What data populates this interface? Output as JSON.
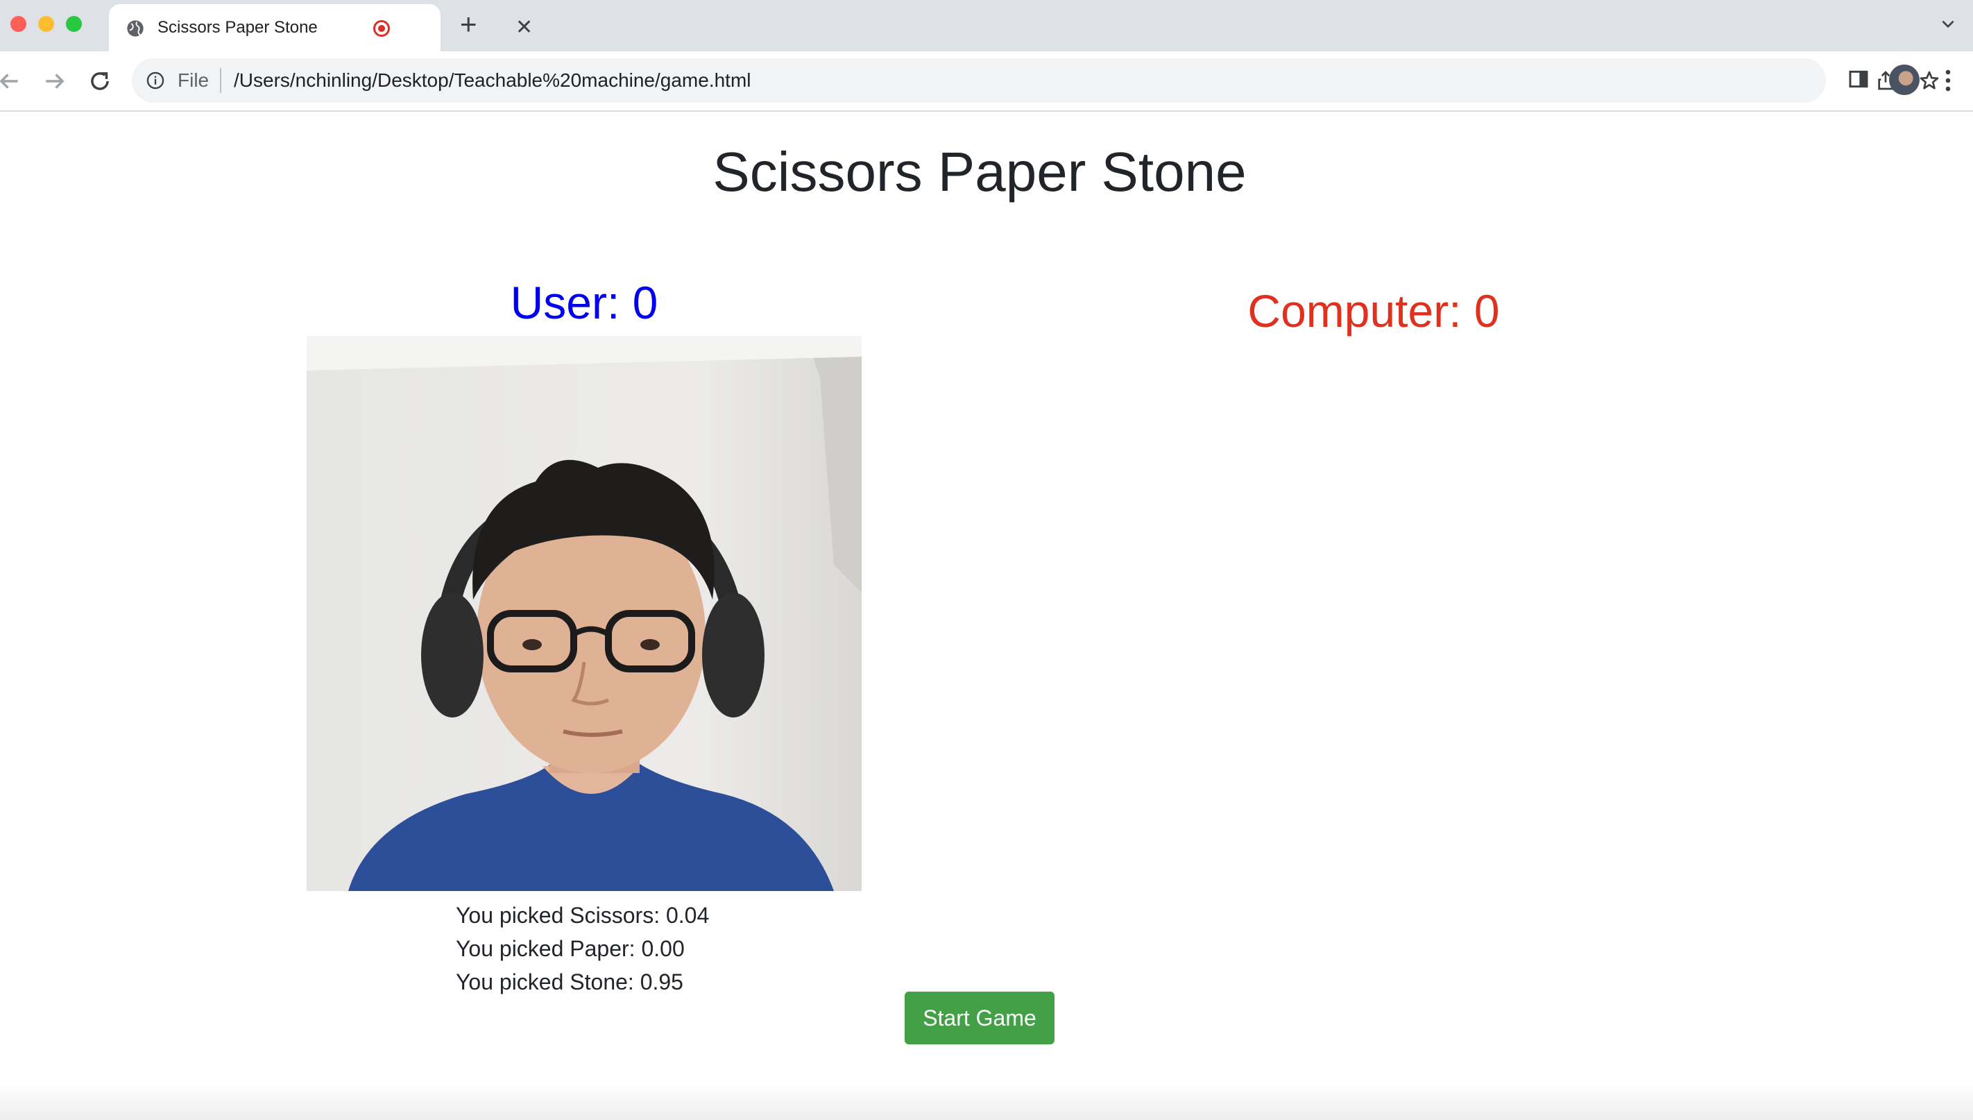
{
  "browser": {
    "tab": {
      "title": "Scissors Paper Stone",
      "icon": "globe-icon",
      "recording_indicator": "record-icon",
      "close_icon": "close-icon"
    },
    "new_tab_icon": "plus-icon",
    "omnibox": {
      "scheme_label": "File",
      "url": "/Users/nchinling/Desktop/Teachable%20machine/game.html"
    },
    "icons": [
      "back-arrow-icon",
      "forward-arrow-icon",
      "reload-icon",
      "info-icon",
      "share-icon",
      "star-icon",
      "side-panel-icon",
      "avatar",
      "menu-icon",
      "chevron-down-icon"
    ]
  },
  "page": {
    "title": "Scissors Paper Stone",
    "user_score": "User: 0",
    "computer_score": "Computer: 0",
    "results": {
      "scissors": "You picked Scissors: 0.04",
      "paper": "You picked Paper: 0.00",
      "stone": "You picked Stone: 0.95"
    },
    "start_button": "Start Game"
  },
  "colors": {
    "user_score": "#0000ee",
    "computer_score": "#e0311e",
    "start_button": "#43a047"
  }
}
